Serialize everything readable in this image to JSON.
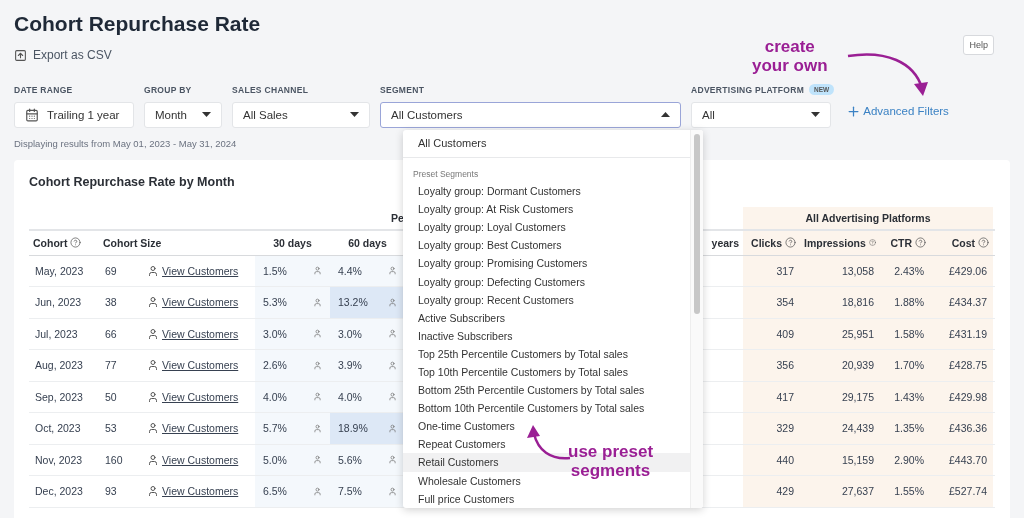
{
  "title": "Cohort Repurchase Rate",
  "export_link": "Export as CSV",
  "help_button": "Help",
  "filters": [
    {
      "kind": "date",
      "label": "DATE RANGE",
      "value": "Trailing 1 year"
    },
    {
      "kind": "select",
      "label": "GROUP BY",
      "value": "Month",
      "open": false
    },
    {
      "kind": "select",
      "label": "SALES CHANNEL",
      "value": "All Sales",
      "open": false
    },
    {
      "kind": "select",
      "label": "SEGMENT",
      "value": "All Customers",
      "open": true
    },
    {
      "kind": "select",
      "label": "ADVERTISING PLATFORM",
      "badge": "NEW",
      "value": "All",
      "open": false
    }
  ],
  "advanced_filters": "Advanced Filters",
  "results_note": "Displaying results from May 01, 2023 - May 31, 2024",
  "card": {
    "title": "Cohort Repurchase Rate by Month",
    "group_headers": [
      "Pe",
      "All Advertising Platforms"
    ],
    "columns": [
      "Cohort",
      "Cohort Size",
      "30 days",
      "60 days",
      "years",
      "Clicks",
      "Impressions",
      "CTR",
      "Cost"
    ],
    "rows": [
      {
        "cohort": "May, 2023",
        "size": "69",
        "link": "View Customers",
        "d30": {
          "text": "1.5%",
          "highlight": false
        },
        "d60": {
          "text": "4.4%",
          "highlight": false
        },
        "clicks": "317",
        "impressions": "13,058",
        "ctr": "2.43%",
        "cost": "£429.06"
      },
      {
        "cohort": "Jun, 2023",
        "size": "38",
        "link": "View Customers",
        "d30": {
          "text": "5.3%",
          "highlight": false
        },
        "d60": {
          "text": "13.2%",
          "highlight": true
        },
        "clicks": "354",
        "impressions": "18,816",
        "ctr": "1.88%",
        "cost": "£434.37"
      },
      {
        "cohort": "Jul, 2023",
        "size": "66",
        "link": "View Customers",
        "d30": {
          "text": "3.0%",
          "highlight": false
        },
        "d60": {
          "text": "3.0%",
          "highlight": false
        },
        "clicks": "409",
        "impressions": "25,951",
        "ctr": "1.58%",
        "cost": "£431.19"
      },
      {
        "cohort": "Aug, 2023",
        "size": "77",
        "link": "View Customers",
        "d30": {
          "text": "2.6%",
          "highlight": false
        },
        "d60": {
          "text": "3.9%",
          "highlight": false
        },
        "clicks": "356",
        "impressions": "20,939",
        "ctr": "1.70%",
        "cost": "£428.75"
      },
      {
        "cohort": "Sep, 2023",
        "size": "50",
        "link": "View Customers",
        "d30": {
          "text": "4.0%",
          "highlight": false
        },
        "d60": {
          "text": "4.0%",
          "highlight": false
        },
        "clicks": "417",
        "impressions": "29,175",
        "ctr": "1.43%",
        "cost": "£429.98"
      },
      {
        "cohort": "Oct, 2023",
        "size": "53",
        "link": "View Customers",
        "d30": {
          "text": "5.7%",
          "highlight": false
        },
        "d60": {
          "text": "18.9%",
          "highlight": true
        },
        "clicks": "329",
        "impressions": "24,439",
        "ctr": "1.35%",
        "cost": "£436.36"
      },
      {
        "cohort": "Nov, 2023",
        "size": "160",
        "link": "View Customers",
        "d30": {
          "text": "5.0%",
          "highlight": false
        },
        "d60": {
          "text": "5.6%",
          "highlight": false
        },
        "clicks": "440",
        "impressions": "15,159",
        "ctr": "2.90%",
        "cost": "£443.70"
      },
      {
        "cohort": "Dec, 2023",
        "size": "93",
        "link": "View Customers",
        "d30": {
          "text": "6.5%",
          "highlight": false
        },
        "d60": {
          "text": "7.5%",
          "highlight": false
        },
        "clicks": "429",
        "impressions": "27,637",
        "ctr": "1.55%",
        "cost": "£527.74"
      }
    ]
  },
  "dropdown": {
    "top_option": "All Customers",
    "group_label": "Preset Segments",
    "options": [
      {
        "label": "Loyalty group: Dormant Customers",
        "hovered": false
      },
      {
        "label": "Loyalty group: At Risk Customers",
        "hovered": false
      },
      {
        "label": "Loyalty group: Loyal Customers",
        "hovered": false
      },
      {
        "label": "Loyalty group: Best Customers",
        "hovered": false
      },
      {
        "label": "Loyalty group: Promising Customers",
        "hovered": false
      },
      {
        "label": "Loyalty group: Defecting Customers",
        "hovered": false
      },
      {
        "label": "Loyalty group: Recent Customers",
        "hovered": false
      },
      {
        "label": "Active Subscribers",
        "hovered": false
      },
      {
        "label": "Inactive Subscribers",
        "hovered": false
      },
      {
        "label": "Top 25th Percentile Customers by Total sales",
        "hovered": false
      },
      {
        "label": "Top 10th Percentile Customers by Total sales",
        "hovered": false
      },
      {
        "label": "Bottom 25th Percentile Customers by Total sales",
        "hovered": false
      },
      {
        "label": "Bottom 10th Percentile Customers by Total sales",
        "hovered": false
      },
      {
        "label": "One-time Customers",
        "hovered": false
      },
      {
        "label": "Repeat Customers",
        "hovered": false
      },
      {
        "label": "Retail Customers",
        "hovered": true
      },
      {
        "label": "Wholesale Customers",
        "hovered": false
      },
      {
        "label": "Full price Customers",
        "hovered": false
      }
    ]
  },
  "annotations": [
    {
      "kind": "top",
      "lines": [
        "create",
        "your own"
      ]
    },
    {
      "kind": "bottom",
      "lines": [
        "use preset",
        "segments"
      ]
    }
  ]
}
